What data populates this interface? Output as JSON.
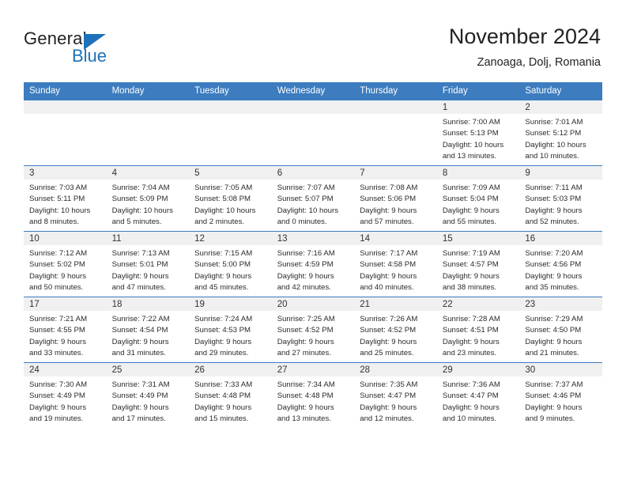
{
  "brand": {
    "name_part1": "General",
    "name_part2": "Blue",
    "accent_color": "#1c71b8",
    "triangle_icon": "brand-triangle-icon"
  },
  "header": {
    "title": "November 2024",
    "subtitle": "Zanoaga, Dolj, Romania"
  },
  "colors": {
    "header_row": "#3c7cbf",
    "daynum_strip": "#f0f0f0",
    "separator": "#3c7cbf",
    "text": "#222222"
  },
  "weekdays": [
    "Sunday",
    "Monday",
    "Tuesday",
    "Wednesday",
    "Thursday",
    "Friday",
    "Saturday"
  ],
  "weeks": [
    [
      {
        "day": "",
        "empty": true
      },
      {
        "day": "",
        "empty": true
      },
      {
        "day": "",
        "empty": true
      },
      {
        "day": "",
        "empty": true
      },
      {
        "day": "",
        "empty": true
      },
      {
        "day": "1",
        "sunrise": "Sunrise: 7:00 AM",
        "sunset": "Sunset: 5:13 PM",
        "daylight1": "Daylight: 10 hours",
        "daylight2": "and 13 minutes."
      },
      {
        "day": "2",
        "sunrise": "Sunrise: 7:01 AM",
        "sunset": "Sunset: 5:12 PM",
        "daylight1": "Daylight: 10 hours",
        "daylight2": "and 10 minutes."
      }
    ],
    [
      {
        "day": "3",
        "sunrise": "Sunrise: 7:03 AM",
        "sunset": "Sunset: 5:11 PM",
        "daylight1": "Daylight: 10 hours",
        "daylight2": "and 8 minutes."
      },
      {
        "day": "4",
        "sunrise": "Sunrise: 7:04 AM",
        "sunset": "Sunset: 5:09 PM",
        "daylight1": "Daylight: 10 hours",
        "daylight2": "and 5 minutes."
      },
      {
        "day": "5",
        "sunrise": "Sunrise: 7:05 AM",
        "sunset": "Sunset: 5:08 PM",
        "daylight1": "Daylight: 10 hours",
        "daylight2": "and 2 minutes."
      },
      {
        "day": "6",
        "sunrise": "Sunrise: 7:07 AM",
        "sunset": "Sunset: 5:07 PM",
        "daylight1": "Daylight: 10 hours",
        "daylight2": "and 0 minutes."
      },
      {
        "day": "7",
        "sunrise": "Sunrise: 7:08 AM",
        "sunset": "Sunset: 5:06 PM",
        "daylight1": "Daylight: 9 hours",
        "daylight2": "and 57 minutes."
      },
      {
        "day": "8",
        "sunrise": "Sunrise: 7:09 AM",
        "sunset": "Sunset: 5:04 PM",
        "daylight1": "Daylight: 9 hours",
        "daylight2": "and 55 minutes."
      },
      {
        "day": "9",
        "sunrise": "Sunrise: 7:11 AM",
        "sunset": "Sunset: 5:03 PM",
        "daylight1": "Daylight: 9 hours",
        "daylight2": "and 52 minutes."
      }
    ],
    [
      {
        "day": "10",
        "sunrise": "Sunrise: 7:12 AM",
        "sunset": "Sunset: 5:02 PM",
        "daylight1": "Daylight: 9 hours",
        "daylight2": "and 50 minutes."
      },
      {
        "day": "11",
        "sunrise": "Sunrise: 7:13 AM",
        "sunset": "Sunset: 5:01 PM",
        "daylight1": "Daylight: 9 hours",
        "daylight2": "and 47 minutes."
      },
      {
        "day": "12",
        "sunrise": "Sunrise: 7:15 AM",
        "sunset": "Sunset: 5:00 PM",
        "daylight1": "Daylight: 9 hours",
        "daylight2": "and 45 minutes."
      },
      {
        "day": "13",
        "sunrise": "Sunrise: 7:16 AM",
        "sunset": "Sunset: 4:59 PM",
        "daylight1": "Daylight: 9 hours",
        "daylight2": "and 42 minutes."
      },
      {
        "day": "14",
        "sunrise": "Sunrise: 7:17 AM",
        "sunset": "Sunset: 4:58 PM",
        "daylight1": "Daylight: 9 hours",
        "daylight2": "and 40 minutes."
      },
      {
        "day": "15",
        "sunrise": "Sunrise: 7:19 AM",
        "sunset": "Sunset: 4:57 PM",
        "daylight1": "Daylight: 9 hours",
        "daylight2": "and 38 minutes."
      },
      {
        "day": "16",
        "sunrise": "Sunrise: 7:20 AM",
        "sunset": "Sunset: 4:56 PM",
        "daylight1": "Daylight: 9 hours",
        "daylight2": "and 35 minutes."
      }
    ],
    [
      {
        "day": "17",
        "sunrise": "Sunrise: 7:21 AM",
        "sunset": "Sunset: 4:55 PM",
        "daylight1": "Daylight: 9 hours",
        "daylight2": "and 33 minutes."
      },
      {
        "day": "18",
        "sunrise": "Sunrise: 7:22 AM",
        "sunset": "Sunset: 4:54 PM",
        "daylight1": "Daylight: 9 hours",
        "daylight2": "and 31 minutes."
      },
      {
        "day": "19",
        "sunrise": "Sunrise: 7:24 AM",
        "sunset": "Sunset: 4:53 PM",
        "daylight1": "Daylight: 9 hours",
        "daylight2": "and 29 minutes."
      },
      {
        "day": "20",
        "sunrise": "Sunrise: 7:25 AM",
        "sunset": "Sunset: 4:52 PM",
        "daylight1": "Daylight: 9 hours",
        "daylight2": "and 27 minutes."
      },
      {
        "day": "21",
        "sunrise": "Sunrise: 7:26 AM",
        "sunset": "Sunset: 4:52 PM",
        "daylight1": "Daylight: 9 hours",
        "daylight2": "and 25 minutes."
      },
      {
        "day": "22",
        "sunrise": "Sunrise: 7:28 AM",
        "sunset": "Sunset: 4:51 PM",
        "daylight1": "Daylight: 9 hours",
        "daylight2": "and 23 minutes."
      },
      {
        "day": "23",
        "sunrise": "Sunrise: 7:29 AM",
        "sunset": "Sunset: 4:50 PM",
        "daylight1": "Daylight: 9 hours",
        "daylight2": "and 21 minutes."
      }
    ],
    [
      {
        "day": "24",
        "sunrise": "Sunrise: 7:30 AM",
        "sunset": "Sunset: 4:49 PM",
        "daylight1": "Daylight: 9 hours",
        "daylight2": "and 19 minutes."
      },
      {
        "day": "25",
        "sunrise": "Sunrise: 7:31 AM",
        "sunset": "Sunset: 4:49 PM",
        "daylight1": "Daylight: 9 hours",
        "daylight2": "and 17 minutes."
      },
      {
        "day": "26",
        "sunrise": "Sunrise: 7:33 AM",
        "sunset": "Sunset: 4:48 PM",
        "daylight1": "Daylight: 9 hours",
        "daylight2": "and 15 minutes."
      },
      {
        "day": "27",
        "sunrise": "Sunrise: 7:34 AM",
        "sunset": "Sunset: 4:48 PM",
        "daylight1": "Daylight: 9 hours",
        "daylight2": "and 13 minutes."
      },
      {
        "day": "28",
        "sunrise": "Sunrise: 7:35 AM",
        "sunset": "Sunset: 4:47 PM",
        "daylight1": "Daylight: 9 hours",
        "daylight2": "and 12 minutes."
      },
      {
        "day": "29",
        "sunrise": "Sunrise: 7:36 AM",
        "sunset": "Sunset: 4:47 PM",
        "daylight1": "Daylight: 9 hours",
        "daylight2": "and 10 minutes."
      },
      {
        "day": "30",
        "sunrise": "Sunrise: 7:37 AM",
        "sunset": "Sunset: 4:46 PM",
        "daylight1": "Daylight: 9 hours",
        "daylight2": "and 9 minutes."
      }
    ]
  ]
}
